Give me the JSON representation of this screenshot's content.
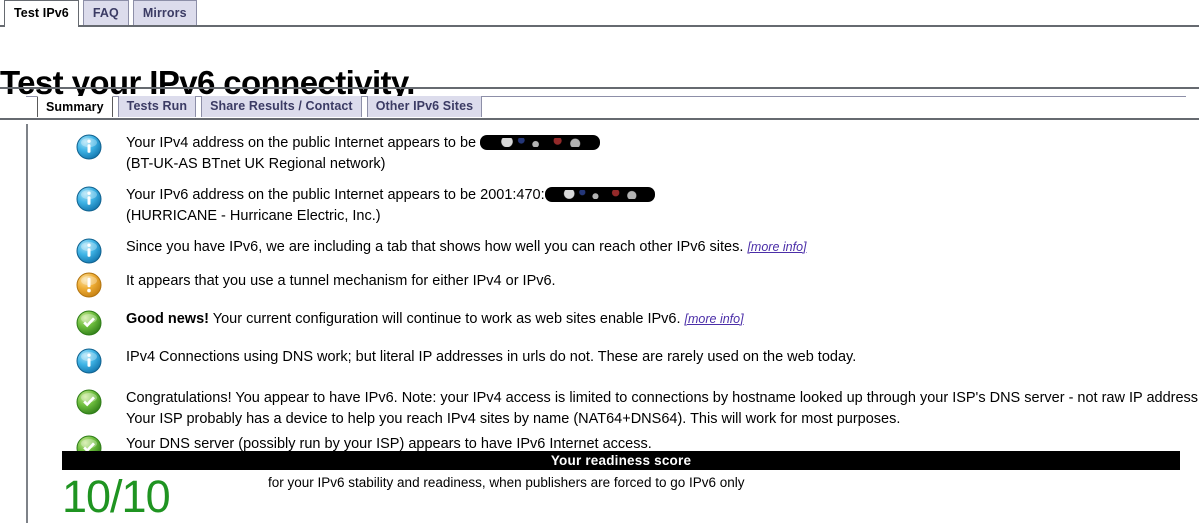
{
  "site_tabs": [
    {
      "label": "Test IPv6",
      "active": true
    },
    {
      "label": "FAQ",
      "active": false
    },
    {
      "label": "Mirrors",
      "active": false
    }
  ],
  "heading": "Test your IPv6 connectivity.",
  "panel_tabs": [
    {
      "label": "Summary",
      "active": true
    },
    {
      "label": "Tests Run",
      "active": false
    },
    {
      "label": "Share Results / Contact",
      "active": false
    },
    {
      "label": "Other IPv6 Sites",
      "active": false
    }
  ],
  "results": {
    "ipv4": {
      "icon": "info-icon",
      "line1_prefix": "Your IPv4 address on the public Internet appears to be ",
      "redacted": "[redacted]",
      "line2": "(BT-UK-AS BTnet UK Regional network)"
    },
    "ipv6": {
      "icon": "info-icon",
      "line1_prefix": "Your IPv6 address on the public Internet appears to be 2001:470:",
      "redacted": "[redacted]",
      "line2": "(HURRICANE - Hurricane Electric, Inc.)"
    },
    "other_sites_tab": {
      "icon": "info-icon",
      "text": "Since you have IPv6, we are including a tab that shows how well you can reach other IPv6 sites. ",
      "link": "[more info]"
    },
    "tunnel": {
      "icon": "warning-icon",
      "text": "It appears that you use a tunnel mechanism for either IPv4 or IPv6."
    },
    "good_news": {
      "icon": "success-icon",
      "strong": "Good news!",
      "text": " Your current configuration will continue to work as web sites enable IPv6. ",
      "link": "[more info]"
    },
    "dns_literal": {
      "icon": "info-icon",
      "text": "IPv4 Connections using DNS work; but literal IP addresses in urls do not. These are rarely used on the web today."
    },
    "congratulations": {
      "icon": "success-icon",
      "text": "Congratulations! You appear to have IPv6. Note: your IPv4 access is limited to connections by hostname looked up through your ISP's DNS server - not raw IP address. Your ISP probably has a device to help you reach IPv4 sites by name (NAT64+DNS64). This will work for most purposes."
    },
    "dns_server": {
      "icon": "success-icon",
      "text": "Your DNS server (possibly run by your ISP) appears to have IPv6 Internet access."
    }
  },
  "score": {
    "bar_label": "Your readiness score",
    "value": "10/10",
    "caption": "for your IPv6 stability and readiness, when publishers are forced to go IPv6 only"
  },
  "colors": {
    "info": "#2f9fd8",
    "warning": "#e8a227",
    "success": "#49ad33",
    "score_green": "#1f9421",
    "tab_inactive": "#dcdcec",
    "tab_text": "#3b3b64",
    "link": "#4b2ea8",
    "rule": "#666a70"
  }
}
